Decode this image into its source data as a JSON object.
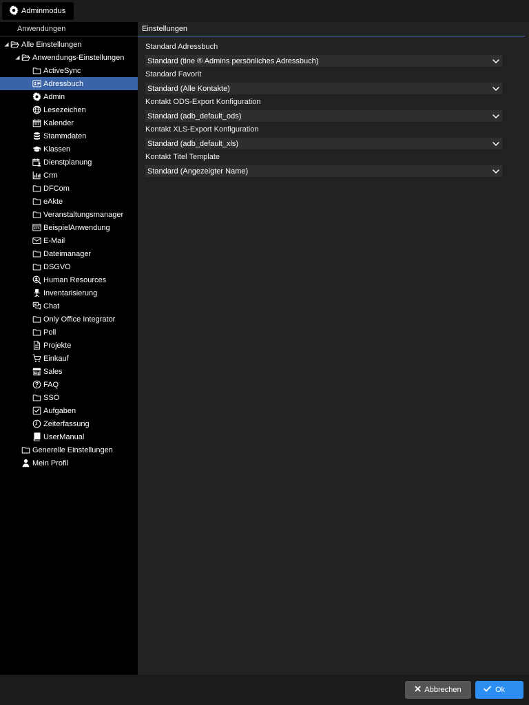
{
  "topbar": {
    "admin_label": "Adminmodus"
  },
  "tree": {
    "header": "Anwendungen",
    "root": {
      "label": "Alle Einstellungen"
    },
    "app_settings": {
      "label": "Anwendungs-Einstellungen"
    },
    "items": [
      {
        "label": "ActiveSync",
        "icon": "folder-icon"
      },
      {
        "label": "Adressbuch",
        "icon": "address-card-icon",
        "selected": true
      },
      {
        "label": "Admin",
        "icon": "gear-icon"
      },
      {
        "label": "Lesezeichen",
        "icon": "globe-icon"
      },
      {
        "label": "Kalender",
        "icon": "calendar-icon"
      },
      {
        "label": "Stammdaten",
        "icon": "database-icon"
      },
      {
        "label": "Klassen",
        "icon": "graduation-cap-icon"
      },
      {
        "label": "Dienstplanung",
        "icon": "calendar-user-icon"
      },
      {
        "label": "Crm",
        "icon": "bar-chart-icon"
      },
      {
        "label": "DFCom",
        "icon": "folder-icon"
      },
      {
        "label": "eAkte",
        "icon": "folder-icon"
      },
      {
        "label": "Veranstaltungsmanager",
        "icon": "folder-icon"
      },
      {
        "label": "BeispielAnwendung",
        "icon": "code-window-icon"
      },
      {
        "label": "E-Mail",
        "icon": "envelope-icon"
      },
      {
        "label": "Dateimanager",
        "icon": "folder-icon"
      },
      {
        "label": "DSGVO",
        "icon": "folder-icon"
      },
      {
        "label": "Human Resources",
        "icon": "user-search-icon"
      },
      {
        "label": "Inventarisierung",
        "icon": "office-chair-icon"
      },
      {
        "label": "Chat",
        "icon": "chat-icon"
      },
      {
        "label": "Only Office Integrator",
        "icon": "folder-icon"
      },
      {
        "label": "Poll",
        "icon": "folder-icon"
      },
      {
        "label": "Projekte",
        "icon": "document-icon"
      },
      {
        "label": "Einkauf",
        "icon": "cart-icon"
      },
      {
        "label": "Sales",
        "icon": "store-icon"
      },
      {
        "label": "FAQ",
        "icon": "question-circle-icon"
      },
      {
        "label": "SSO",
        "icon": "folder-icon"
      },
      {
        "label": "Aufgaben",
        "icon": "checkbox-icon"
      },
      {
        "label": "Zeiterfassung",
        "icon": "clock-icon"
      },
      {
        "label": "UserManual",
        "icon": "book-icon"
      }
    ],
    "general": {
      "label": "Generelle Einstellungen",
      "icon": "folder-icon"
    },
    "profile": {
      "label": "Mein Profil",
      "icon": "user-icon"
    }
  },
  "content": {
    "header": "Einstellungen",
    "fields": [
      {
        "label": "Standard Adressbuch",
        "value": "Standard (tine ® Admins persönliches Adressbuch)"
      },
      {
        "label": "Standard Favorit",
        "value": "Standard (Alle Kontakte)"
      },
      {
        "label": "Kontakt ODS-Export Konfiguration",
        "value": "Standard (adb_default_ods)"
      },
      {
        "label": "Kontakt XLS-Export Konfiguration",
        "value": "Standard (adb_default_xls)"
      },
      {
        "label": "Kontakt Titel Template",
        "value": "Standard (Angezeigter Name)"
      }
    ]
  },
  "footer": {
    "cancel_label": "Abbrechen",
    "ok_label": "Ok"
  },
  "colors": {
    "selection": "#3a63a8",
    "ok_button": "#2b8ef0",
    "cancel_button": "#545454",
    "header_line": "#3e6aa5"
  }
}
